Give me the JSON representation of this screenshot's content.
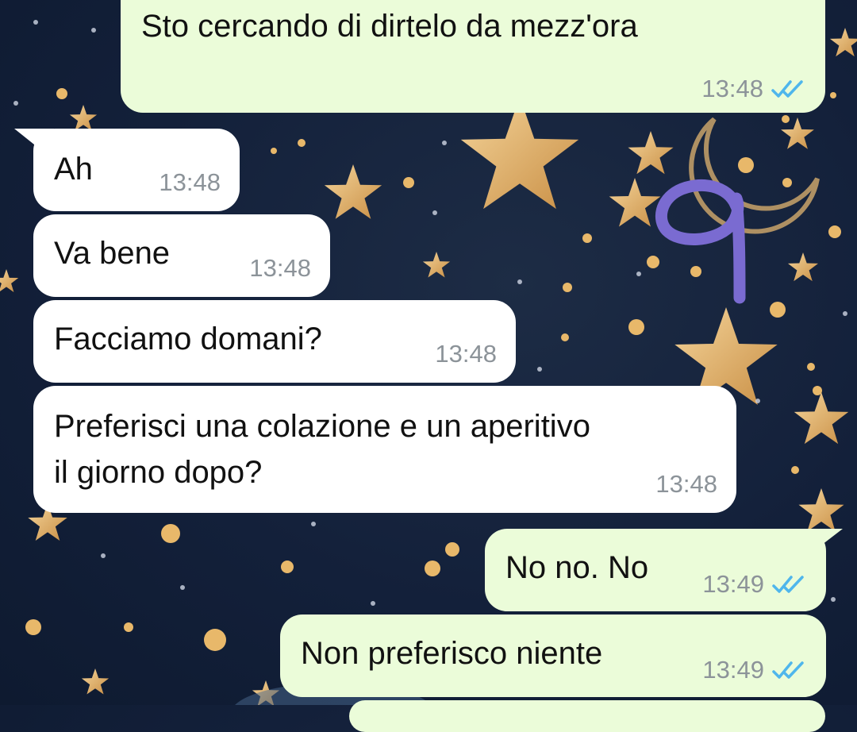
{
  "chat": {
    "messages": [
      {
        "direction": "out",
        "text": "Sto cercando di dirtelo da mezz'ora",
        "time": "13:48",
        "status": "read"
      },
      {
        "direction": "in",
        "text": "Ah",
        "time": "13:48"
      },
      {
        "direction": "in",
        "text": "Va bene",
        "time": "13:48"
      },
      {
        "direction": "in",
        "text": "Facciamo domani?",
        "time": "13:48"
      },
      {
        "direction": "in",
        "text_line1": "Preferisci una colazione e un aperitivo",
        "text_line2": "il giorno dopo?",
        "time": "13:48"
      },
      {
        "direction": "out",
        "text": "No no. No",
        "time": "13:49",
        "status": "read"
      },
      {
        "direction": "out",
        "text": "Non preferisco niente",
        "time": "13:49",
        "status": "read"
      }
    ],
    "annotation": "9"
  },
  "colors": {
    "incoming_bubble": "#ffffff",
    "outgoing_bubble": "#ebfcd9",
    "read_ticks": "#4fb6ec",
    "timestamp": "#8c9399",
    "wallpaper": "#13203a",
    "stars": "#e8b86a",
    "annotation_ink": "#7a6bd1"
  },
  "icons": {
    "read_receipt": "double-check-icon"
  }
}
